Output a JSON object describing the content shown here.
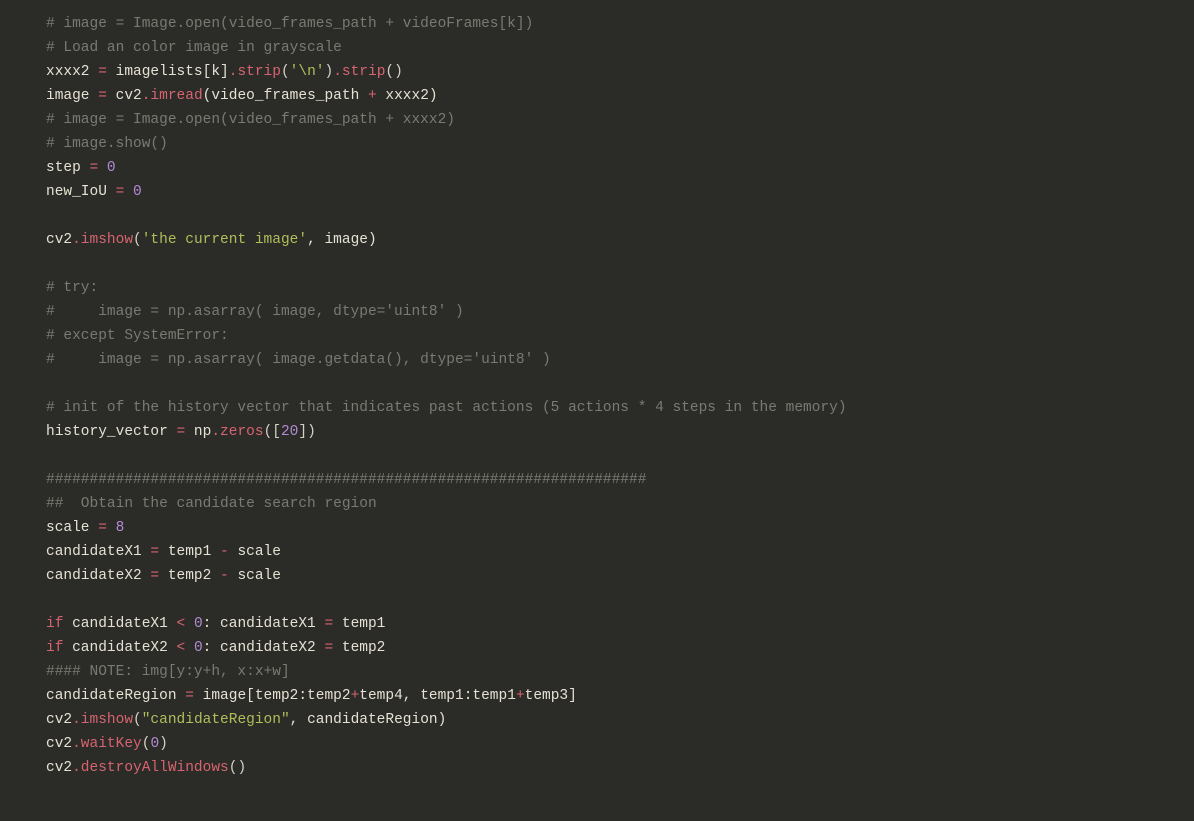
{
  "code": {
    "l1": "# image = Image.open(video_frames_path + videoFrames[k])",
    "l2": "# Load an color image in grayscale",
    "l3a": "xxxx2 ",
    "l3b": "=",
    "l3c": " imagelists[k]",
    "l3d": ".strip",
    "l3e": "(",
    "l3f": "'\\n'",
    "l3g": ")",
    "l3h": ".strip",
    "l3i": "()",
    "l4a": "image ",
    "l4b": "=",
    "l4c": " cv2",
    "l4d": ".imread",
    "l4e": "(video_frames_path ",
    "l4f": "+",
    "l4g": " xxxx2)",
    "l5": "# image = Image.open(video_frames_path + xxxx2)",
    "l6": "# image.show()",
    "l7a": "step ",
    "l7b": "=",
    "l7c": " ",
    "l7d": "0",
    "l8a": "new_IoU ",
    "l8b": "=",
    "l8c": " ",
    "l8d": "0",
    "l10a": "cv2",
    "l10b": ".imshow",
    "l10c": "(",
    "l10d": "'the current image'",
    "l10e": ", image)",
    "l12": "# try:",
    "l13": "#     image = np.asarray( image, dtype='uint8' )",
    "l14": "# except SystemError:",
    "l15": "#     image = np.asarray( image.getdata(), dtype='uint8' )",
    "l17": "# init of the history vector that indicates past actions (5 actions * 4 steps in the memory)",
    "l18a": "history_vector ",
    "l18b": "=",
    "l18c": " np",
    "l18d": ".zeros",
    "l18e": "([",
    "l18f": "20",
    "l18g": "])",
    "l20": "#####################################################################",
    "l21": "##  Obtain the candidate search region",
    "l22a": "scale ",
    "l22b": "=",
    "l22c": " ",
    "l22d": "8",
    "l23a": "candidateX1 ",
    "l23b": "=",
    "l23c": " temp1 ",
    "l23d": "-",
    "l23e": " scale",
    "l24a": "candidateX2 ",
    "l24b": "=",
    "l24c": " temp2 ",
    "l24d": "-",
    "l24e": " scale",
    "l26a": "if",
    "l26b": " candidateX1 ",
    "l26c": "<",
    "l26d": " ",
    "l26e": "0",
    "l26f": ": candidateX1 ",
    "l26g": "=",
    "l26h": " temp1",
    "l27a": "if",
    "l27b": " candidateX2 ",
    "l27c": "<",
    "l27d": " ",
    "l27e": "0",
    "l27f": ": candidateX2 ",
    "l27g": "=",
    "l27h": " temp2",
    "l28": "#### NOTE: img[y:y+h, x:x+w]",
    "l29a": "candidateRegion ",
    "l29b": "=",
    "l29c": " image[temp2:temp2",
    "l29d": "+",
    "l29e": "temp4, temp1:temp1",
    "l29f": "+",
    "l29g": "temp3]",
    "l30a": "cv2",
    "l30b": ".imshow",
    "l30c": "(",
    "l30d": "\"candidateRegion\"",
    "l30e": ", candidateRegion)",
    "l31a": "cv2",
    "l31b": ".waitKey",
    "l31c": "(",
    "l31d": "0",
    "l31e": ")",
    "l32a": "cv2",
    "l32b": ".destroyAllWindows",
    "l32c": "()"
  }
}
